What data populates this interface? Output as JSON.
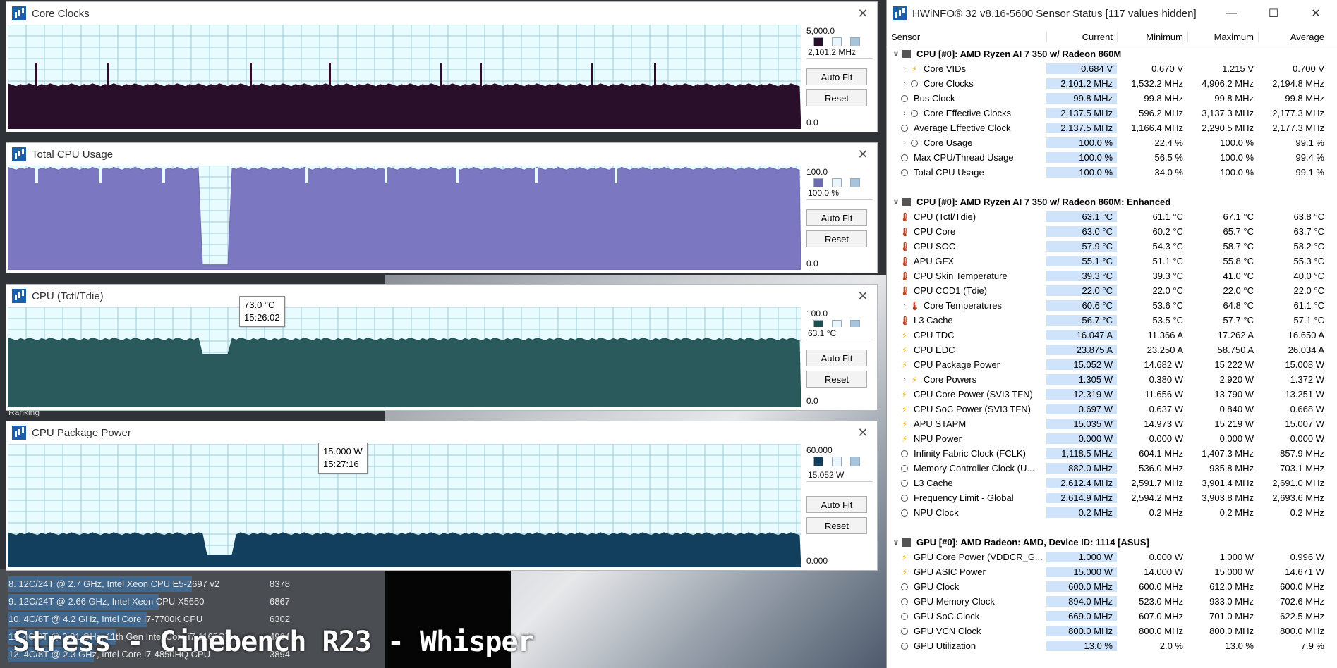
{
  "background": {
    "ranking_label": "Ranking",
    "rankings": [
      {
        "label": "8. 12C/24T @ 2.7 GHz, Intel Xeon CPU E5-2697 v2",
        "score": "8378"
      },
      {
        "label": "9. 12C/24T @ 2.66 GHz, Intel Xeon CPU X5650",
        "score": "6867"
      },
      {
        "label": "10. 4C/8T @ 4.2 GHz, Intel Core i7-7700K CPU",
        "score": "6302"
      },
      {
        "label": "11. 4C/8T @ 2.81 GHz, 11th Gen Intel Core i7-1165G7",
        "score": "4904"
      },
      {
        "label": "12. 4C/8T @ 2.3 GHz, Intel Core i7-4850HQ CPU",
        "score": "3894"
      }
    ],
    "caption": "Stress - Cinebench R23 - Whisper"
  },
  "graphs": [
    {
      "title": "Core Clocks",
      "max": "5,000.0",
      "current": "2,101.2 MHz",
      "min": "0.0",
      "color": "#2a0f2a",
      "fill": "#2a0f2a",
      "level": 0.42,
      "dips": [],
      "spikes": [
        0.035,
        0.125,
        0.305,
        0.405,
        0.545,
        0.595,
        0.735,
        0.815
      ],
      "autofit": "Auto Fit",
      "reset": "Reset"
    },
    {
      "title": "Total CPU Usage",
      "max": "100.0",
      "current": "100.0 %",
      "min": "0.0",
      "color": "#6e6ab0",
      "fill": "#7b77c0",
      "level": 0.97,
      "dips": [
        [
          0.245,
          0.28,
          0.05
        ]
      ],
      "spikes": [],
      "notches": [
        0.035,
        0.115,
        0.195,
        0.375,
        0.475,
        0.565,
        0.665,
        0.765
      ],
      "autofit": "Auto Fit",
      "reset": "Reset"
    },
    {
      "title": "CPU (Tctl/Tdie)",
      "max": "100.0",
      "current": "63.1 °C",
      "min": "0.0",
      "color": "#1e4f50",
      "fill": "#2a5a5b",
      "level": 0.68,
      "dips": [
        [
          0.245,
          0.28,
          0.53
        ]
      ],
      "spikes": [],
      "autofit": "Auto Fit",
      "reset": "Reset",
      "tooltip": {
        "value": "73.0 °C",
        "time": "15:26:02"
      }
    },
    {
      "title": "CPU Package Power",
      "max": "60.000",
      "current": "15.052 W",
      "min": "0.000",
      "color": "#0f3d5a",
      "fill": "#133f5e",
      "level": 0.27,
      "dips": [
        [
          0.25,
          0.285,
          0.1
        ]
      ],
      "spikes": [],
      "autofit": "Auto Fit",
      "reset": "Reset",
      "tooltip": {
        "value": "15.000 W",
        "time": "15:27:16"
      }
    }
  ],
  "hwinfo": {
    "title": "HWiNFO® 32 v8.16-5600 Sensor Status [117 values hidden]",
    "columns": {
      "sensor": "Sensor",
      "current": "Current",
      "minimum": "Minimum",
      "maximum": "Maximum",
      "average": "Average"
    },
    "groups": [
      {
        "name": "CPU [#0]: AMD Ryzen AI 7 350 w/ Radeon 860M",
        "rows": [
          {
            "icon": "bolt",
            "expand": true,
            "label": "Core VIDs",
            "cur": "0.684 V",
            "min": "0.670 V",
            "max": "1.215 V",
            "avg": "0.700 V"
          },
          {
            "icon": "clock",
            "expand": true,
            "label": "Core Clocks",
            "cur": "2,101.2 MHz",
            "min": "1,532.2 MHz",
            "max": "4,906.2 MHz",
            "avg": "2,194.8 MHz"
          },
          {
            "icon": "clock",
            "expand": false,
            "label": "Bus Clock",
            "cur": "99.8 MHz",
            "min": "99.8 MHz",
            "max": "99.8 MHz",
            "avg": "99.8 MHz"
          },
          {
            "icon": "clock",
            "expand": true,
            "label": "Core Effective Clocks",
            "cur": "2,137.5 MHz",
            "min": "596.2 MHz",
            "max": "3,137.3 MHz",
            "avg": "2,177.3 MHz"
          },
          {
            "icon": "clock",
            "expand": false,
            "label": "Average Effective Clock",
            "cur": "2,137.5 MHz",
            "min": "1,166.4 MHz",
            "max": "2,290.5 MHz",
            "avg": "2,177.3 MHz"
          },
          {
            "icon": "clock",
            "expand": true,
            "label": "Core Usage",
            "cur": "100.0 %",
            "min": "22.4 %",
            "max": "100.0 %",
            "avg": "99.1 %"
          },
          {
            "icon": "clock",
            "expand": false,
            "label": "Max CPU/Thread Usage",
            "cur": "100.0 %",
            "min": "56.5 %",
            "max": "100.0 %",
            "avg": "99.4 %"
          },
          {
            "icon": "clock",
            "expand": false,
            "label": "Total CPU Usage",
            "cur": "100.0 %",
            "min": "34.0 %",
            "max": "100.0 %",
            "avg": "99.1 %"
          }
        ]
      },
      {
        "name": "CPU [#0]: AMD Ryzen AI 7 350 w/ Radeon 860M: Enhanced",
        "rows": [
          {
            "icon": "therm",
            "expand": false,
            "label": "CPU (Tctl/Tdie)",
            "cur": "63.1 °C",
            "min": "61.1 °C",
            "max": "67.1 °C",
            "avg": "63.8 °C"
          },
          {
            "icon": "therm",
            "expand": false,
            "label": "CPU Core",
            "cur": "63.0 °C",
            "min": "60.2 °C",
            "max": "65.7 °C",
            "avg": "63.7 °C"
          },
          {
            "icon": "therm",
            "expand": false,
            "label": "CPU SOC",
            "cur": "57.9 °C",
            "min": "54.3 °C",
            "max": "58.7 °C",
            "avg": "58.2 °C"
          },
          {
            "icon": "therm",
            "expand": false,
            "label": "APU GFX",
            "cur": "55.1 °C",
            "min": "51.1 °C",
            "max": "55.8 °C",
            "avg": "55.3 °C"
          },
          {
            "icon": "therm",
            "expand": false,
            "label": "CPU Skin Temperature",
            "cur": "39.3 °C",
            "min": "39.3 °C",
            "max": "41.0 °C",
            "avg": "40.0 °C"
          },
          {
            "icon": "therm",
            "expand": false,
            "label": "CPU CCD1 (Tdie)",
            "cur": "22.0 °C",
            "min": "22.0 °C",
            "max": "22.0 °C",
            "avg": "22.0 °C"
          },
          {
            "icon": "therm",
            "expand": true,
            "label": "Core Temperatures",
            "cur": "60.6 °C",
            "min": "53.6 °C",
            "max": "64.8 °C",
            "avg": "61.1 °C"
          },
          {
            "icon": "therm",
            "expand": false,
            "label": "L3 Cache",
            "cur": "56.7 °C",
            "min": "53.5 °C",
            "max": "57.7 °C",
            "avg": "57.1 °C"
          },
          {
            "icon": "bolt",
            "expand": false,
            "label": "CPU TDC",
            "cur": "16.047 A",
            "min": "11.366 A",
            "max": "17.262 A",
            "avg": "16.650 A"
          },
          {
            "icon": "bolt",
            "expand": false,
            "label": "CPU EDC",
            "cur": "23.875 A",
            "min": "23.250 A",
            "max": "58.750 A",
            "avg": "26.034 A"
          },
          {
            "icon": "bolt",
            "expand": false,
            "label": "CPU Package Power",
            "cur": "15.052 W",
            "min": "14.682 W",
            "max": "15.222 W",
            "avg": "15.008 W"
          },
          {
            "icon": "bolt",
            "expand": true,
            "label": "Core Powers",
            "cur": "1.305 W",
            "min": "0.380 W",
            "max": "2.920 W",
            "avg": "1.372 W"
          },
          {
            "icon": "bolt",
            "expand": false,
            "label": "CPU Core Power (SVI3 TFN)",
            "cur": "12.319 W",
            "min": "11.656 W",
            "max": "13.790 W",
            "avg": "13.251 W"
          },
          {
            "icon": "bolt",
            "expand": false,
            "label": "CPU SoC Power (SVI3 TFN)",
            "cur": "0.697 W",
            "min": "0.637 W",
            "max": "0.840 W",
            "avg": "0.668 W"
          },
          {
            "icon": "bolt",
            "expand": false,
            "label": "APU STAPM",
            "cur": "15.035 W",
            "min": "14.973 W",
            "max": "15.219 W",
            "avg": "15.007 W"
          },
          {
            "icon": "bolt",
            "expand": false,
            "label": "NPU Power",
            "cur": "0.000 W",
            "min": "0.000 W",
            "max": "0.000 W",
            "avg": "0.000 W"
          },
          {
            "icon": "clock",
            "expand": false,
            "label": "Infinity Fabric Clock (FCLK)",
            "cur": "1,118.5 MHz",
            "min": "604.1 MHz",
            "max": "1,407.3 MHz",
            "avg": "857.9 MHz"
          },
          {
            "icon": "clock",
            "expand": false,
            "label": "Memory Controller Clock (U...",
            "cur": "882.0 MHz",
            "min": "536.0 MHz",
            "max": "935.8 MHz",
            "avg": "703.1 MHz"
          },
          {
            "icon": "clock",
            "expand": false,
            "label": "L3 Cache",
            "cur": "2,612.4 MHz",
            "min": "2,591.7 MHz",
            "max": "3,901.4 MHz",
            "avg": "2,691.0 MHz"
          },
          {
            "icon": "clock",
            "expand": false,
            "label": "Frequency Limit - Global",
            "cur": "2,614.9 MHz",
            "min": "2,594.2 MHz",
            "max": "3,903.8 MHz",
            "avg": "2,693.6 MHz"
          },
          {
            "icon": "clock",
            "expand": false,
            "label": "NPU Clock",
            "cur": "0.2 MHz",
            "min": "0.2 MHz",
            "max": "0.2 MHz",
            "avg": "0.2 MHz"
          }
        ]
      },
      {
        "name": "GPU [#0]: AMD Radeon: AMD, Device ID: 1114 [ASUS]",
        "rows": [
          {
            "icon": "bolt",
            "expand": false,
            "label": "GPU Core Power (VDDCR_G...",
            "cur": "1.000 W",
            "min": "0.000 W",
            "max": "1.000 W",
            "avg": "0.996 W"
          },
          {
            "icon": "bolt",
            "expand": false,
            "label": "GPU ASIC Power",
            "cur": "15.000 W",
            "min": "14.000 W",
            "max": "15.000 W",
            "avg": "14.671 W"
          },
          {
            "icon": "clock",
            "expand": false,
            "label": "GPU Clock",
            "cur": "600.0 MHz",
            "min": "600.0 MHz",
            "max": "612.0 MHz",
            "avg": "600.0 MHz"
          },
          {
            "icon": "clock",
            "expand": false,
            "label": "GPU Memory Clock",
            "cur": "894.0 MHz",
            "min": "523.0 MHz",
            "max": "933.0 MHz",
            "avg": "702.6 MHz"
          },
          {
            "icon": "clock",
            "expand": false,
            "label": "GPU SoC Clock",
            "cur": "669.0 MHz",
            "min": "607.0 MHz",
            "max": "701.0 MHz",
            "avg": "622.5 MHz"
          },
          {
            "icon": "clock",
            "expand": false,
            "label": "GPU VCN Clock",
            "cur": "800.0 MHz",
            "min": "800.0 MHz",
            "max": "800.0 MHz",
            "avg": "800.0 MHz"
          },
          {
            "icon": "clock",
            "expand": false,
            "label": "GPU Utilization",
            "cur": "13.0 %",
            "min": "2.0 %",
            "max": "13.0 %",
            "avg": "7.9 %"
          }
        ]
      }
    ]
  }
}
